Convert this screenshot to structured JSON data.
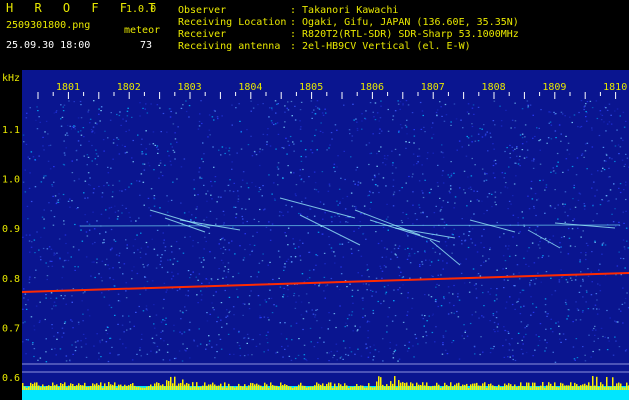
{
  "app": {
    "name": "H R O F F T",
    "version": "1.0.0"
  },
  "file": {
    "name": "2509301800.png",
    "datetime": "25.09.30 18:00"
  },
  "meteor": {
    "label": "meteor",
    "count": "73"
  },
  "info": {
    "observer_label": "Observer",
    "observer_value": ": Takanori Kawachi",
    "location_label": "Receiving Location",
    "location_value": ": Ogaki, Gifu, JAPAN (136.60E, 35.35N)",
    "receiver_label": "Receiver",
    "receiver_value": ": R820T2(RTL-SDR) SDR-Sharp 53.1000MHz",
    "antenna_label": "Receiving antenna",
    "antenna_value": ": 2el-HB9CV Vertical (el. E-W)"
  },
  "spectrogram": {
    "y_unit": "kHz",
    "time_labels": [
      "1801",
      "1802",
      "1803",
      "1804",
      "1805",
      "1806",
      "1807",
      "1808",
      "1809",
      "1810"
    ],
    "freq_labels": [
      "1.1",
      "1.0",
      "0.9",
      "0.8",
      "0.7",
      "0.6"
    ],
    "colors": {
      "background": "#0a1590",
      "text": "#e8e800",
      "trace": "#ff2a00",
      "signal_bar": "#00e6ff",
      "spike": "#ffef00",
      "tick": "#ffffff"
    }
  }
}
